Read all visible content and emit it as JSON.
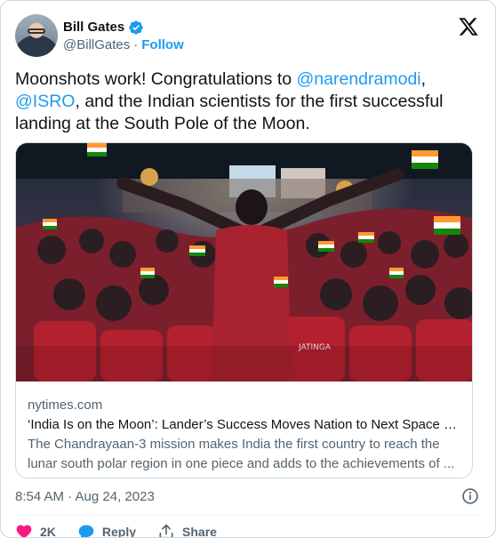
{
  "author": {
    "display_name": "Bill Gates",
    "handle": "@BillGates",
    "separator": "·",
    "follow_label": "Follow",
    "verified_color": "#1d9bf0"
  },
  "tweet": {
    "text_part1": "Moonshots work! Congratulations to ",
    "mention1": "@narendramodi",
    "text_part2": ",",
    "mention2": "@ISRO",
    "text_part3": ", and the Indian scientists for the first successful landing at the South Pole of the Moon."
  },
  "link_card": {
    "domain": "nytimes.com",
    "title": "‘India Is on the Moon’: Lander’s Success Moves Nation to Next Space Ch...",
    "description": "The Chandrayaan-3 mission makes India the first country to reach the lunar south polar region in one piece and adds to the achievements of ...",
    "shirt_text": "JATINGA"
  },
  "meta": {
    "timestamp": "8:54 AM · Aug 24, 2023"
  },
  "actions": {
    "like_count": "2K",
    "reply_label": "Reply",
    "share_label": "Share"
  },
  "colors": {
    "accent": "#1d9bf0",
    "like": "#f91880",
    "text": "#0f1419",
    "muted": "#536471"
  },
  "icons": [
    "verified-badge-icon",
    "x-logo-icon",
    "info-icon",
    "heart-icon",
    "reply-bubble-icon",
    "share-icon"
  ]
}
